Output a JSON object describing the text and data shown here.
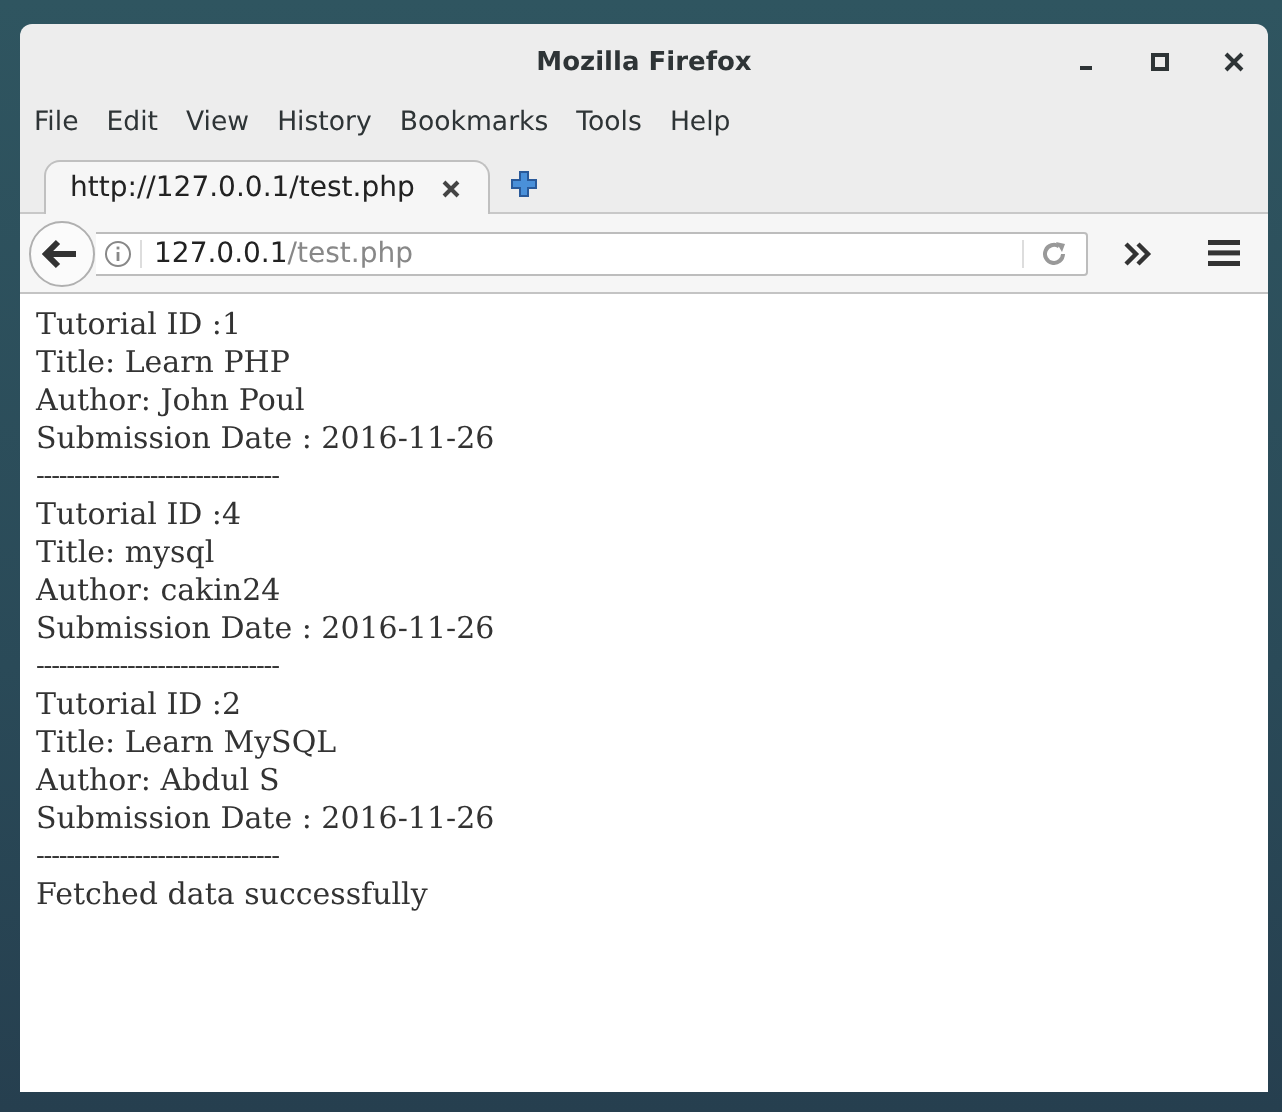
{
  "window": {
    "title": "Mozilla Firefox"
  },
  "menu": [
    "File",
    "Edit",
    "View",
    "History",
    "Bookmarks",
    "Tools",
    "Help"
  ],
  "tabs": [
    {
      "label": "http://127.0.0.1/test.php",
      "selected": true
    }
  ],
  "address_bar": {
    "host": "127.0.0.1",
    "path": "/test.php"
  },
  "content": {
    "records": [
      {
        "lines": [
          "Tutorial ID :1",
          "Title: Learn PHP",
          "Author: John Poul",
          "Submission Date : 2016-11-26"
        ],
        "separator": "--------------------------------"
      },
      {
        "lines": [
          "Tutorial ID :4",
          "Title: mysql",
          "Author: cakin24",
          "Submission Date : 2016-11-26"
        ],
        "separator": "--------------------------------"
      },
      {
        "lines": [
          "Tutorial ID :2",
          "Title: Learn MySQL",
          "Author: Abdul S",
          "Submission Date : 2016-11-26"
        ],
        "separator": "--------------------------------"
      }
    ],
    "message": "Fetched data successfully"
  }
}
